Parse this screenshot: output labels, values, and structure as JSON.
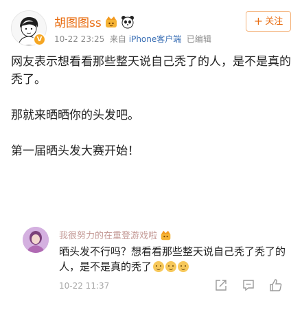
{
  "post": {
    "author": {
      "name": "胡图图ss",
      "verified_badge": "V"
    },
    "time": "10-22 23:25",
    "source_prefix": "来自",
    "source": "iPhone客户端",
    "edited": "已编辑",
    "follow_label": "关注",
    "paragraphs": [
      "网友表示想看看那些整天说自己秃了的人，是不是真的秃了。",
      "那就来晒晒你的头发吧。",
      "第一届晒头发大赛开始！"
    ]
  },
  "comment": {
    "author": "我很努力的在重登游戏啦",
    "text": "晒头发不行吗？想看看那些整天说自己秃了秃了的人，是不是真的秃了",
    "time": "10-22 11:37"
  },
  "icons": {
    "name_suffix": [
      "crown-emoji-icon",
      "panda-emoji-icon"
    ],
    "comment_actions": [
      "share-icon",
      "comment-icon",
      "like-icon"
    ]
  },
  "colors": {
    "username": "#e86b0f",
    "follow_border": "#f4b27a",
    "source_link": "#3a6fb5",
    "comment_author": "#c49a96"
  }
}
